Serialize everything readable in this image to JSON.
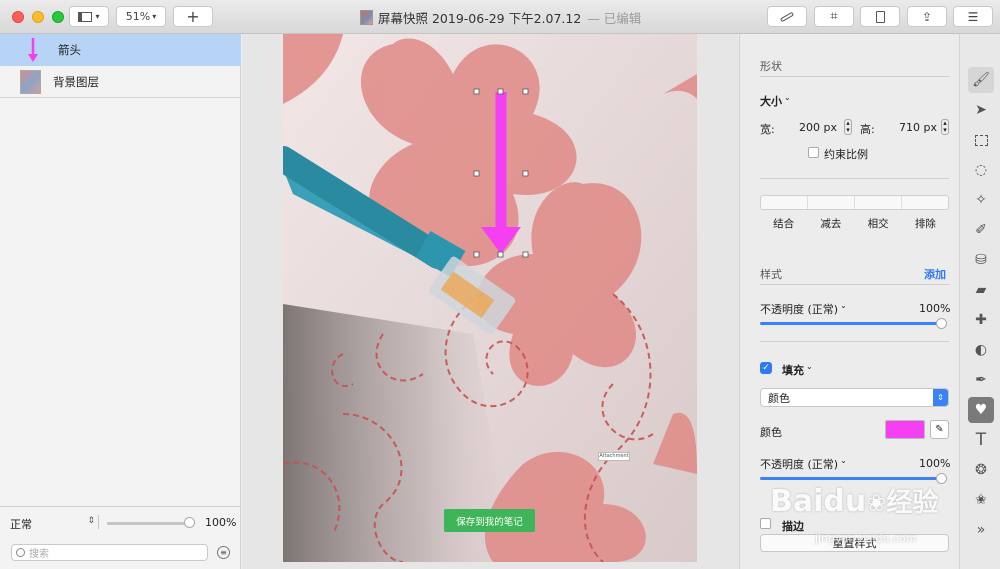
{
  "window": {
    "title": "屏幕快照 2019-06-29 下午2.07.12",
    "edited": "— 已编辑",
    "zoom": "51%"
  },
  "layers": [
    {
      "name": "箭头"
    },
    {
      "name": "背景图层"
    }
  ],
  "sidebar_footer": {
    "blend": "正常",
    "opacity": "100%",
    "search_placeholder": "搜索"
  },
  "inspector": {
    "shape_label": "形状",
    "size_label": "大小",
    "width_label": "宽:",
    "width_value": "200 px",
    "height_label": "高:",
    "height_value": "710 px",
    "constrain_label": "约束比例",
    "boolean_ops": [
      "结合",
      "减去",
      "相交",
      "排除"
    ],
    "style_label": "样式",
    "add_label": "添加",
    "opacity_label": "不透明度 (正常)",
    "opacity_value": "100%",
    "fill_label": "填充",
    "fill_type": "颜色",
    "color_label": "颜色",
    "fill_color": "#f53ff2",
    "fill_opacity_label": "不透明度 (正常)",
    "fill_opacity_value": "100%",
    "stroke_label": "描边",
    "reset_label": "重置样式"
  },
  "canvas": {
    "save_note": "保存到我的笔记",
    "attachment": "Attachment"
  },
  "watermark": {
    "brand": "Baidu",
    "text": "经验",
    "url": "jingyan.baidu.com"
  },
  "tools": [
    "paint-bucket-icon",
    "arrow-pointer-icon",
    "rect-select-icon",
    "lasso-icon",
    "magic-wand-icon",
    "brush-icon",
    "bucket-icon",
    "eraser-icon",
    "bandage-icon",
    "clone-icon",
    "pen-icon",
    "heart-shape-icon",
    "text-icon",
    "color-adjust-icon",
    "star-icon",
    "more-icon"
  ]
}
